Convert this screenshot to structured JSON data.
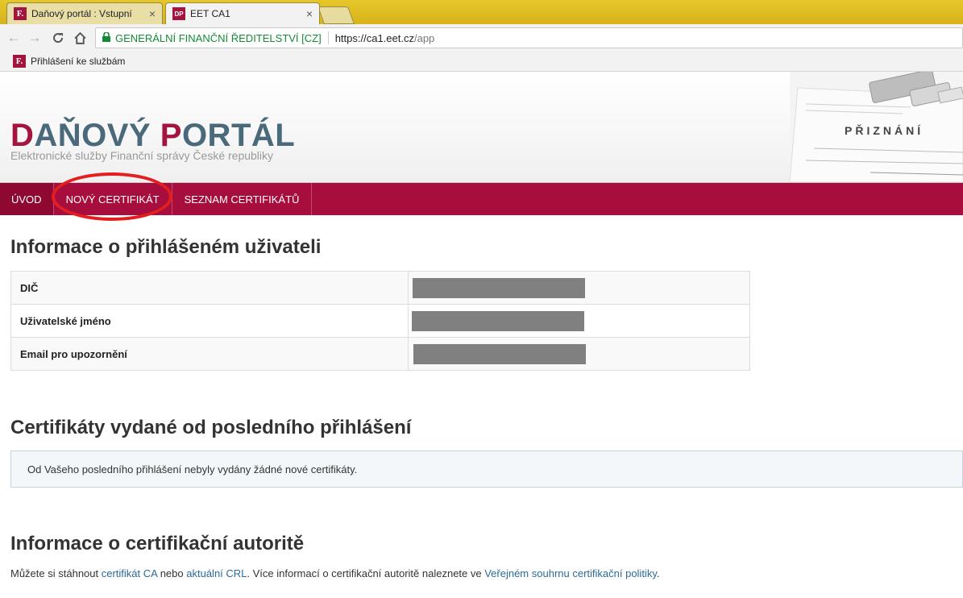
{
  "browser": {
    "tabs": [
      {
        "title": "Daňový portál : Vstupní",
        "favicon": "F.",
        "active": false
      },
      {
        "title": "EET CA1",
        "favicon": "DP",
        "active": true
      }
    ],
    "close_glyph": "×",
    "org": "GENERÁLNÍ FINANČNÍ ŘEDITELSTVÍ [CZ]",
    "url_host": "https://ca1.eet.cz",
    "url_path": "/app",
    "bookmark": "Přihlášení ke službám",
    "bookmark_favicon": "F."
  },
  "header": {
    "logo_d": "D",
    "logo_mid": "AŇOVÝ ",
    "logo_p": "P",
    "logo_end": "ORTÁL",
    "subtitle": "Elektronické služby Finanční správy České republiky",
    "image_caption": "PŘIZNÁNÍ"
  },
  "nav": {
    "items": [
      "ÚVOD",
      "NOVÝ CERTIFIKÁT",
      "SEZNAM CERTIFIKÁTŮ"
    ]
  },
  "user_info": {
    "heading": "Informace o přihlášeném uživateli",
    "rows": [
      {
        "label": "DIČ"
      },
      {
        "label": "Uživatelské jméno"
      },
      {
        "label": "Email pro upozornění"
      }
    ]
  },
  "certificates": {
    "heading": "Certifikáty vydané od posledního přihlášení",
    "message": "Od Vašeho posledního přihlášení nebyly vydány žádné nové certifikáty."
  },
  "ca_info": {
    "heading": "Informace o certifikační autoritě",
    "text1": "Můžete si stáhnout ",
    "link1": "certifikát CA",
    "text2": " nebo ",
    "link2": "aktuální CRL",
    "text3": ". Více informací o certifikační autoritě naleznete ve ",
    "link3": "Veřejném souhrnu certifikační politiky",
    "text4": "."
  },
  "colors": {
    "brand": "#a70d3d",
    "logo_blue": "#4a6a7c",
    "link": "#2b6a9a",
    "secure_green": "#138a36"
  }
}
